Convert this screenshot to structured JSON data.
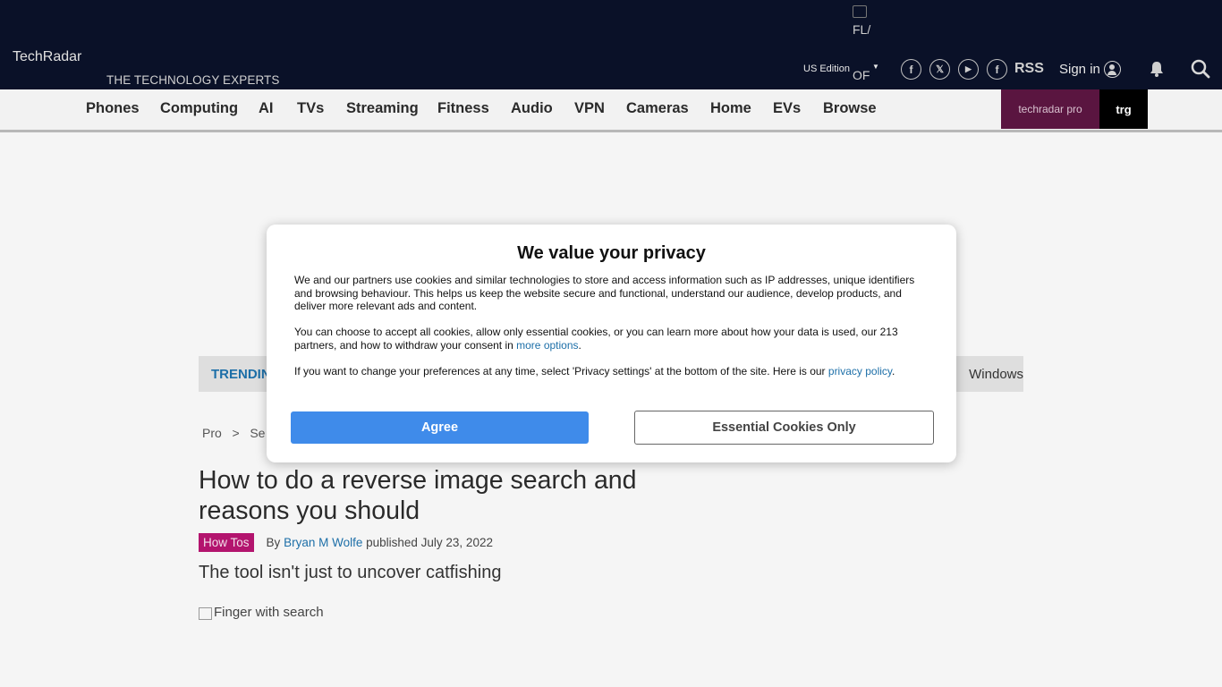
{
  "header": {
    "logo_alt": "TechRadar",
    "tagline": "THE TECHNOLOGY EXPERTS",
    "flag_alt_1": "FL/",
    "flag_alt_2": "OF",
    "edition": "US Edition",
    "rss": "RSS",
    "signin": "Sign in",
    "social": {
      "facebook": "f",
      "x": "𝕏",
      "youtube": "▶",
      "flipboard": "f"
    }
  },
  "nav": {
    "items": [
      "Phones",
      "Computing",
      "AI",
      "TVs",
      "Streaming",
      "Fitness",
      "Audio",
      "VPN",
      "Cameras",
      "Home",
      "EVs",
      "Browse"
    ],
    "techradar_pro": "techradar pro",
    "trg": "trg"
  },
  "trending": {
    "label": "TRENDIN",
    "right_item": "Windows"
  },
  "breadcrumb": {
    "first": "Pro",
    "sep": ">",
    "second": "Se"
  },
  "article": {
    "title": "How to do a reverse image search and reasons you should",
    "tag": "How Tos",
    "by": "By",
    "author": "Bryan M Wolfe",
    "published": "published July 23, 2022",
    "subtitle": "The tool isn't just to uncover catfishing",
    "image_alt": "Finger with search"
  },
  "consent": {
    "title": "We value your privacy",
    "p1": "We and our partners use cookies and similar technologies to store and access information such as IP addresses, unique identifiers and browsing behaviour. This helps us keep the website secure and functional, understand our audience, develop products, and deliver more relevant ads and content.",
    "p2_pre": "You can choose to accept all cookies, allow only essential cookies, or you can learn more about how your data is used, our 213 partners, and how to withdraw your consent in ",
    "p2_link": "more options",
    "p2_post": ".",
    "p3_pre": "If you want to change your preferences at any time, select 'Privacy settings' at the bottom of the site. Here is our ",
    "p3_link": "privacy policy",
    "p3_post": ".",
    "agree": "Agree",
    "essential": "Essential Cookies Only"
  }
}
